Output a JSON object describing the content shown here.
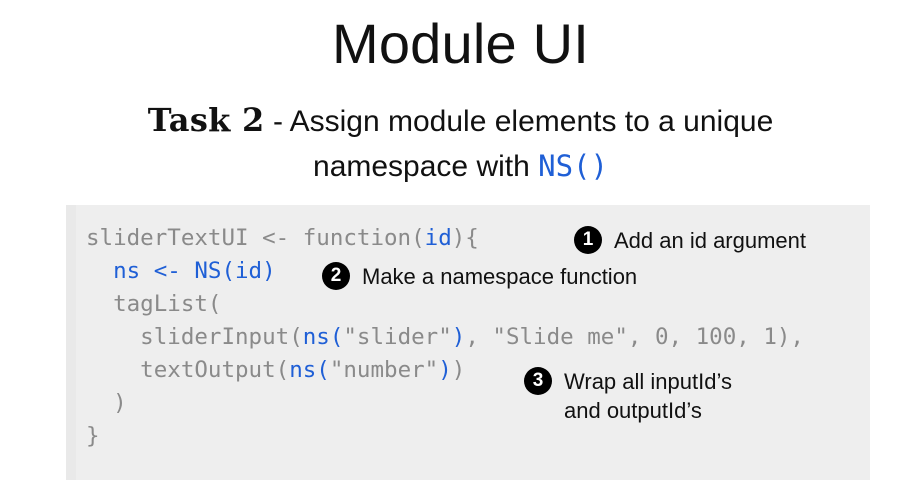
{
  "slide": {
    "title": "Module UI",
    "subtitle": {
      "task_label": "Task 2",
      "text_before": " - Assign module elements to a unique",
      "text_line2": "namespace with ",
      "code": "NS()"
    }
  },
  "code": {
    "line1_a": "sliderTextUI <- function(",
    "line1_b": "id",
    "line1_c": "){",
    "line2_indent": "  ",
    "line2_code": "ns <- NS(id)",
    "line3": "  tagList(",
    "line4_a": "    sliderInput(",
    "line4_b": "ns(",
    "line4_c": "\"slider\"",
    "line4_d": ")",
    "line4_e": ", \"Slide me\", 0, 100, 1),",
    "line5_a": "    textOutput(",
    "line5_b": "ns(",
    "line5_c": "\"number\"",
    "line5_d": ")",
    "line5_e": ")",
    "line6": "  )",
    "line7": "}"
  },
  "annotations": [
    {
      "number": "1",
      "text": "Add an id argument"
    },
    {
      "number": "2",
      "text": "Make a namespace function"
    },
    {
      "number": "3",
      "text": "Wrap all inputId’s\nand outputId’s"
    }
  ],
  "colors": {
    "accent": "#1f5fd6",
    "code_gray": "#8a8a8a",
    "panel": "#eeeeee"
  }
}
